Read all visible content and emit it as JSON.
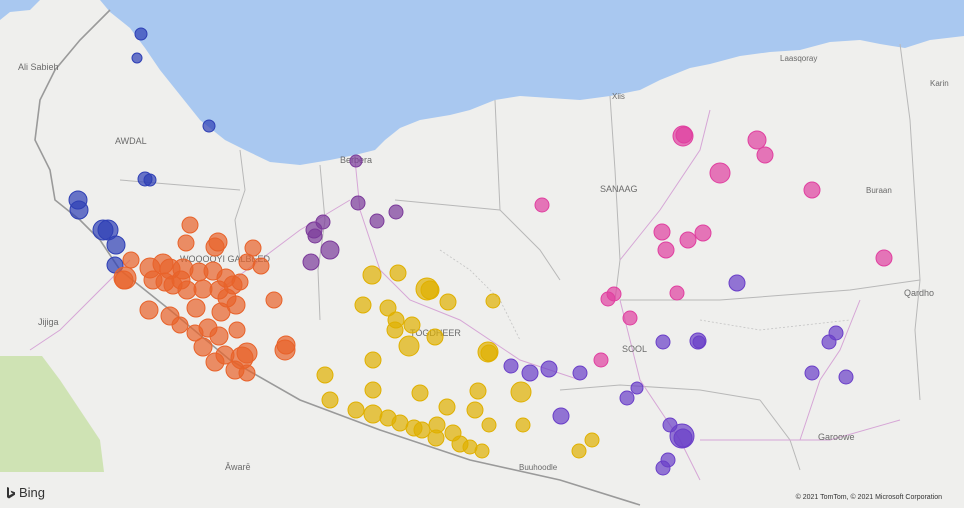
{
  "labels": [
    {
      "id": "ali-sabieh",
      "text": "Ali Sabieh"
    },
    {
      "id": "awdal",
      "text": "AWDAL"
    },
    {
      "id": "berbera",
      "text": "Berbera"
    },
    {
      "id": "woqooyi-galbeed",
      "text": "WOQOOYI GALBEED"
    },
    {
      "id": "togdheer",
      "text": "TOGDHEER"
    },
    {
      "id": "sanaag",
      "text": "SANAAG"
    },
    {
      "id": "sool",
      "text": "SOOL"
    },
    {
      "id": "laasqoray",
      "text": "Laasqoray"
    },
    {
      "id": "xiis",
      "text": "Xiis"
    },
    {
      "id": "karin",
      "text": "Karin"
    },
    {
      "id": "buraan",
      "text": "Buraan"
    },
    {
      "id": "qardho",
      "text": "Qardho"
    },
    {
      "id": "jijiga",
      "text": "Jijiga"
    },
    {
      "id": "garoowe",
      "text": "Garoowe"
    },
    {
      "id": "awaare",
      "text": "Āwarē"
    },
    {
      "id": "buuhoodle",
      "text": "Buuhoodle"
    }
  ],
  "legend_colors": {
    "awdal": "#2e3fb5",
    "woqooyi_galbeed": "#e8622a",
    "berbera": "#7b3a9a",
    "togdheer": "#e0b000",
    "sanaag": "#e040a0",
    "sool": "#6a3fc8"
  },
  "attribution": {
    "provider": "Bing",
    "copyright": "© 2021 TomTom, © 2021 Microsoft Corporation"
  }
}
